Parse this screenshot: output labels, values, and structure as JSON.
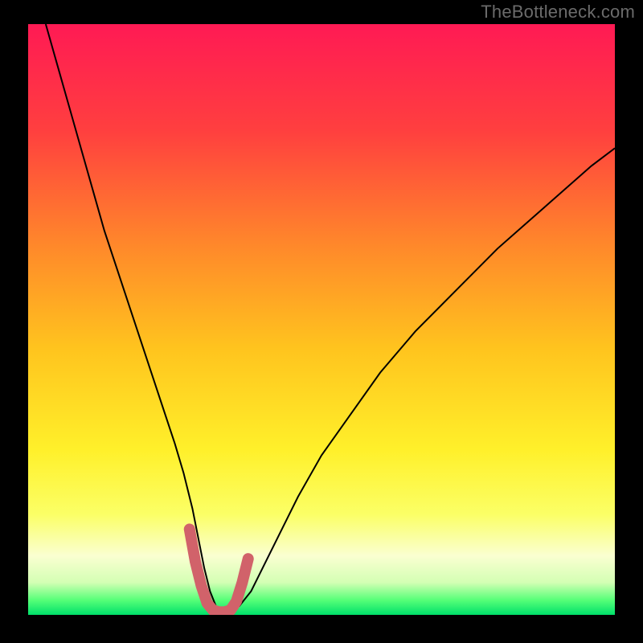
{
  "watermark": "TheBottleneck.com",
  "chart_data": {
    "type": "line",
    "title": "",
    "xlabel": "",
    "ylabel": "",
    "xlim": [
      0,
      100
    ],
    "ylim": [
      0,
      100
    ],
    "grid": false,
    "legend": false,
    "background_gradient": {
      "stops": [
        {
          "offset": 0.0,
          "color": "#ff1a54"
        },
        {
          "offset": 0.18,
          "color": "#ff3f3f"
        },
        {
          "offset": 0.38,
          "color": "#ff8a2a"
        },
        {
          "offset": 0.55,
          "color": "#ffc41e"
        },
        {
          "offset": 0.72,
          "color": "#fff02a"
        },
        {
          "offset": 0.83,
          "color": "#fbff66"
        },
        {
          "offset": 0.9,
          "color": "#faffd1"
        },
        {
          "offset": 0.945,
          "color": "#d4ffb4"
        },
        {
          "offset": 0.975,
          "color": "#56ff78"
        },
        {
          "offset": 1.0,
          "color": "#00e06a"
        }
      ]
    },
    "series": [
      {
        "name": "bottleneck-curve",
        "stroke": "#000000",
        "stroke_width": 2,
        "x": [
          3,
          5,
          7,
          9,
          11,
          13,
          15,
          17,
          19,
          21,
          23,
          25,
          26.5,
          28,
          29,
          30,
          31,
          32,
          33,
          34,
          36,
          38,
          40,
          43,
          46,
          50,
          55,
          60,
          66,
          72,
          80,
          88,
          96,
          100
        ],
        "y": [
          100,
          93,
          86,
          79,
          72,
          65,
          59,
          53,
          47,
          41,
          35,
          29,
          24,
          18,
          13,
          8,
          4,
          1.5,
          0.6,
          0.6,
          1.5,
          4,
          8,
          14,
          20,
          27,
          34,
          41,
          48,
          54,
          62,
          69,
          76,
          79
        ]
      },
      {
        "name": "sweet-spot-marker",
        "stroke": "#d1626a",
        "stroke_width": 14,
        "linecap": "round",
        "x": [
          27.5,
          28.5,
          29.5,
          30.5,
          31.5,
          32.5,
          33.5,
          34.5,
          35.5,
          36.5,
          37.5
        ],
        "y": [
          14.5,
          9,
          5,
          2,
          0.8,
          0.5,
          0.5,
          0.8,
          2.3,
          5.5,
          9.5
        ]
      }
    ]
  }
}
